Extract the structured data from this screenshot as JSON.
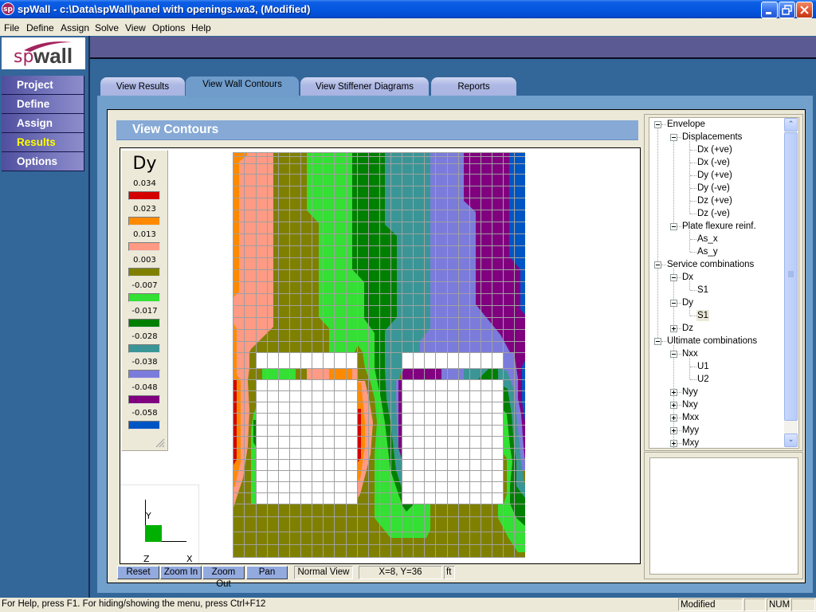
{
  "window": {
    "title": "spWall - c:\\Data\\spWall\\panel with openings.wa3, (Modified)",
    "app_icon": "sp",
    "controls": [
      "minimize",
      "restore",
      "close"
    ]
  },
  "menu": [
    "File",
    "Define",
    "Assign",
    "Solve",
    "View",
    "Options",
    "Help"
  ],
  "logo": {
    "prefix": "sp",
    "suffix": "wall"
  },
  "sidebar": {
    "items": [
      {
        "label": "Project",
        "active": false
      },
      {
        "label": "Define",
        "active": false
      },
      {
        "label": "Assign",
        "active": false
      },
      {
        "label": "Results",
        "active": true
      },
      {
        "label": "Options",
        "active": false
      }
    ]
  },
  "tabs": [
    {
      "label": "View Results",
      "active": false
    },
    {
      "label": "View Wall Contours",
      "active": true
    },
    {
      "label": "View Stiffener Diagrams",
      "active": false
    },
    {
      "label": "Reports",
      "active": false
    }
  ],
  "panel": {
    "title": "View Contours"
  },
  "legend": {
    "title": "Dy",
    "items": [
      {
        "value": "0.034",
        "color": "#d40000"
      },
      {
        "value": "0.023",
        "color": "#ff8a00"
      },
      {
        "value": "0.013",
        "color": "#ff9a84"
      },
      {
        "value": "0.003",
        "color": "#808000"
      },
      {
        "value": "-0.007",
        "color": "#33e033"
      },
      {
        "value": "-0.017",
        "color": "#008000"
      },
      {
        "value": "-0.028",
        "color": "#3a9696"
      },
      {
        "value": "-0.038",
        "color": "#7b7bdc"
      },
      {
        "value": "-0.048",
        "color": "#800080"
      },
      {
        "value": "-0.058",
        "color": "#0055c4"
      }
    ]
  },
  "axes": {
    "y": "Y",
    "z": "Z",
    "x": "X"
  },
  "toolbar": {
    "reset": "Reset",
    "zoom_in": "Zoom In",
    "zoom_out": "Zoom Out",
    "pan": "Pan",
    "view_mode": "Normal View",
    "coordinates": "X=8, Y=36",
    "units": "ft"
  },
  "tree": {
    "items": [
      {
        "label": "Envelope",
        "level": 0,
        "expander": "minus"
      },
      {
        "label": "Displacements",
        "level": 1,
        "expander": "minus"
      },
      {
        "label": "Dx (+ve)",
        "level": 2
      },
      {
        "label": "Dx (-ve)",
        "level": 2
      },
      {
        "label": "Dy (+ve)",
        "level": 2
      },
      {
        "label": "Dy (-ve)",
        "level": 2
      },
      {
        "label": "Dz (+ve)",
        "level": 2
      },
      {
        "label": "Dz (-ve)",
        "level": 2
      },
      {
        "label": "Plate flexure reinf.",
        "level": 1,
        "expander": "minus"
      },
      {
        "label": "As_x",
        "level": 2
      },
      {
        "label": "As_y",
        "level": 2
      },
      {
        "label": "Service combinations",
        "level": 0,
        "expander": "minus"
      },
      {
        "label": "Dx",
        "level": 1,
        "expander": "minus"
      },
      {
        "label": "S1",
        "level": 2
      },
      {
        "label": "Dy",
        "level": 1,
        "expander": "minus"
      },
      {
        "label": "S1",
        "level": 2,
        "selected": true
      },
      {
        "label": "Dz",
        "level": 1,
        "expander": "plus"
      },
      {
        "label": "Ultimate combinations",
        "level": 0,
        "expander": "minus"
      },
      {
        "label": "Nxx",
        "level": 1,
        "expander": "minus"
      },
      {
        "label": "U1",
        "level": 2
      },
      {
        "label": "U2",
        "level": 2
      },
      {
        "label": "Nyy",
        "level": 1,
        "expander": "plus"
      },
      {
        "label": "Nxy",
        "level": 1,
        "expander": "plus"
      },
      {
        "label": "Mxx",
        "level": 1,
        "expander": "plus"
      },
      {
        "label": "Myy",
        "level": 1,
        "expander": "plus"
      },
      {
        "label": "Mxy",
        "level": 1,
        "expander": "plus"
      }
    ]
  },
  "status": {
    "help": "For Help, press F1. For hiding/showing the menu, press Ctrl+F12",
    "panels": [
      "Modified",
      "",
      "NUM",
      ""
    ]
  }
}
